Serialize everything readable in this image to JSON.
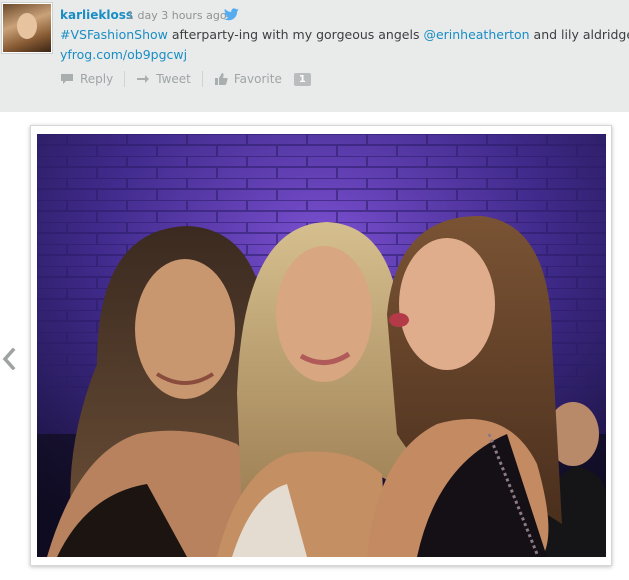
{
  "tweet": {
    "username": "karliekloss",
    "timestamp": "1 day 3 hours ago",
    "hashtag": "#VSFashionShow",
    "text_part1": " afterparty-ing with my gorgeous angels ",
    "mention": "@erinheatherton",
    "text_part2": " and lily aldridge",
    "short_url": "yfrog.com/ob9pgcwj",
    "avatar_icon": "user-avatar",
    "source_icon": "twitter-bird-icon"
  },
  "actions": {
    "reply_label": "Reply",
    "tweet_label": "Tweet",
    "favorite_label": "Favorite",
    "favorite_count": "1"
  },
  "gallery": {
    "prev_icon": "chevron-left-icon",
    "photo_alt": "group photo"
  },
  "colors": {
    "link": "#1a8dc4",
    "bar_background": "#e9ebeb",
    "muted_text": "#9fa4a4"
  }
}
